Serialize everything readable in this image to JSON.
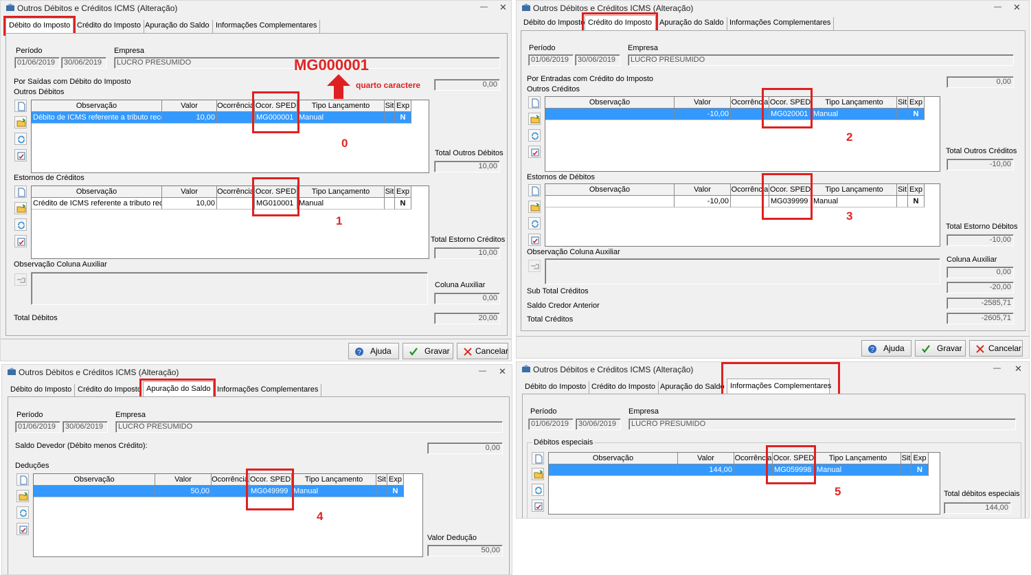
{
  "window_title": "Outros Débitos e Créditos ICMS (Alteração)",
  "tabs": [
    "Débito do Imposto",
    "Crédito do Imposto",
    "Apuração do Saldo",
    "Informações Complementares"
  ],
  "labels": {
    "periodo": "Período",
    "empresa": "Empresa",
    "date_from": "01/06/2019",
    "date_to": "30/06/2019",
    "empresa_value": "LUCRO PRESUMIDO"
  },
  "columns": [
    "Observação",
    "Valor",
    "Ocorrência",
    "Ocor. SPED",
    "Tipo Lançamento",
    "Sit",
    "Exp"
  ],
  "buttons": {
    "ajuda": "Ajuda",
    "gravar": "Gravar",
    "cancelar": "Cancelar"
  },
  "annotations": {
    "highlight_code": "MG000001",
    "arrow_note": "quarto caractere",
    "n0": "0",
    "n1": "1",
    "n2": "2",
    "n3": "3",
    "n4": "4",
    "n5": "5"
  },
  "w1": {
    "section_saidas": "Por Saídas com Débito do Imposto",
    "saidas_value": "0,00",
    "outros_debitos": "Outros Débitos",
    "row1": {
      "obs": "Débito de ICMS referente a tributo reco",
      "valor": "10,00",
      "sped": "MG000001",
      "tipo": "Manual",
      "exp": "N"
    },
    "total_outros_debitos_label": "Total Outros Débitos",
    "total_outros_debitos": "10,00",
    "estornos_creditos": "Estornos de Créditos",
    "row2": {
      "obs": "Crédito de ICMS referente a tributo reco",
      "valor": "10,00",
      "sped": "MG010001",
      "tipo": "Manual",
      "exp": "N"
    },
    "total_estorno_label": "Total Estorno Créditos",
    "total_estorno": "10,00",
    "obs_aux_label": "Observação Coluna Auxiliar",
    "coluna_aux_label": "Coluna Auxiliar",
    "coluna_aux": "0,00",
    "total_debitos_label": "Total Débitos",
    "total_debitos": "20,00"
  },
  "w2": {
    "section_entradas": "Por Entradas com Crédito do Imposto",
    "entradas_value": "0,00",
    "outros_creditos": "Outros Créditos",
    "row1": {
      "obs": "",
      "valor": "-10,00",
      "sped": "MG020001",
      "tipo": "Manual",
      "exp": "N"
    },
    "total_outros_creditos_label": "Total Outros Créditos",
    "total_outros_creditos": "-10,00",
    "estornos_debitos": "Estornos de Débitos",
    "row2": {
      "obs": "",
      "valor": "-10,00",
      "sped": "MG039999",
      "tipo": "Manual",
      "exp": "N"
    },
    "total_estorno_label": "Total Estorno Débitos",
    "total_estorno": "-10,00",
    "obs_aux_label": "Observação Coluna Auxiliar",
    "coluna_aux_label": "Coluna Auxiliar",
    "coluna_aux": "0,00",
    "sub_total_label": "Sub Total Créditos",
    "sub_total": "-20,00",
    "saldo_credor_label": "Saldo Credor Anterior",
    "saldo_credor": "-2585,71",
    "total_creditos_label": "Total Créditos",
    "total_creditos": "-2605,71"
  },
  "w3": {
    "saldo_devedor_label": "Saldo Devedor (Débito menos Crédito):",
    "saldo_devedor": "0,00",
    "deducoes": "Deduções",
    "row1": {
      "obs": "",
      "valor": "50,00",
      "sped": "MG049999",
      "tipo": "Manual",
      "exp": "N"
    },
    "valor_deducao_label": "Valor Dedução",
    "valor_deducao": "50,00"
  },
  "w4": {
    "debitos_especiais": "Débitos especiais",
    "row1": {
      "obs": "",
      "valor": "144,00",
      "sped": "MG059998",
      "tipo": "Manual",
      "exp": "N"
    },
    "total_especiais_label": "Total débitos especiais",
    "total_especiais": "144,00"
  },
  "colors": {
    "selection": "#3399ff",
    "highlight": "#e02020"
  }
}
